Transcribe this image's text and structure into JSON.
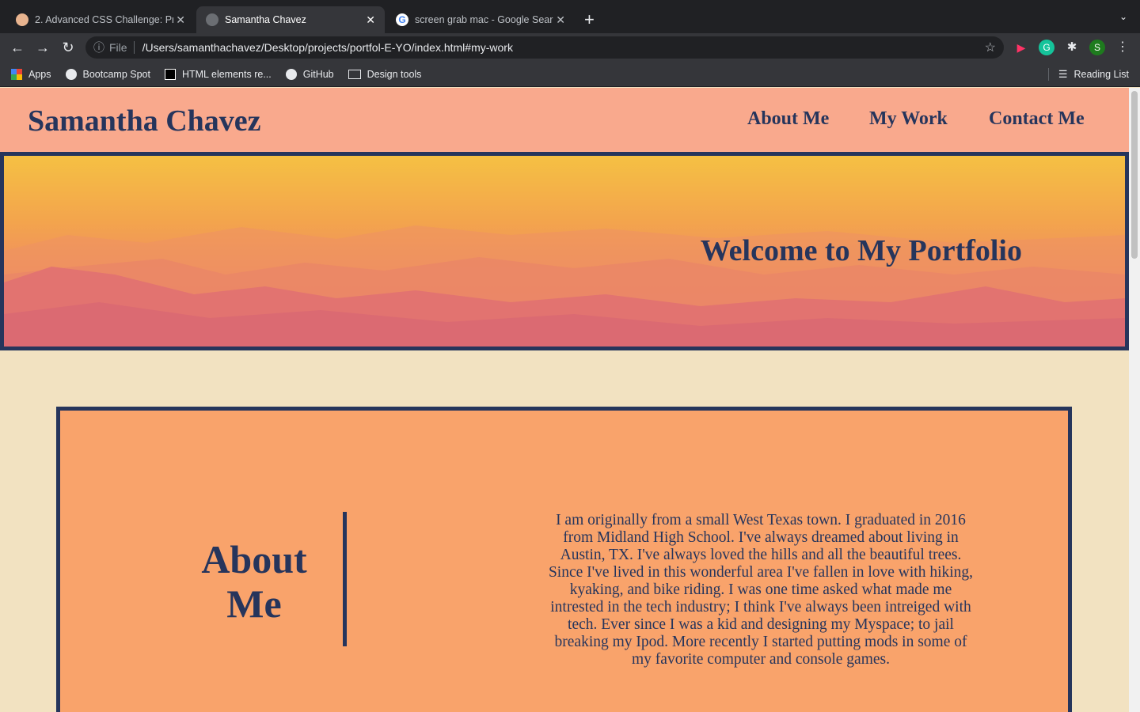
{
  "browser": {
    "tabs": [
      {
        "title": "2. Advanced CSS Challenge: Pr",
        "icon": "bootcamp-icon"
      },
      {
        "title": "Samantha Chavez",
        "icon": "globe-icon",
        "active": true
      },
      {
        "title": "screen grab mac - Google Sear",
        "icon": "google-icon"
      }
    ],
    "new_tab": "+",
    "address": {
      "scheme_label": "File",
      "url": "/Users/samanthachavez/Desktop/projects/portfol-E-YO/index.html#my-work"
    },
    "profile_initial": "S",
    "bookmarks": [
      "Apps",
      "Bootcamp Spot",
      "HTML elements re...",
      "GitHub",
      "Design tools"
    ],
    "reading_list": "Reading List"
  },
  "site": {
    "brand": "Samantha Chavez",
    "nav": [
      "About Me",
      "My Work",
      "Contact Me"
    ],
    "hero_title": "Welcome to My Portfolio",
    "about": {
      "heading": "About Me",
      "text": "I am originally from a small West Texas town. I graduated in 2016 from Midland High School. I've always dreamed about living in Austin, TX. I've always loved the hills and all the beautiful trees. Since I've lived in this wonderful area I've fallen in love with hiking, kyaking, and bike riding. I was one time asked what made me intrested in the tech industry; I think I've always been intreiged with tech. Ever since I was a kid and designing my Myspace; to jail breaking my Ipod. More recently I started putting mods in some of my favorite computer and console games."
    }
  }
}
